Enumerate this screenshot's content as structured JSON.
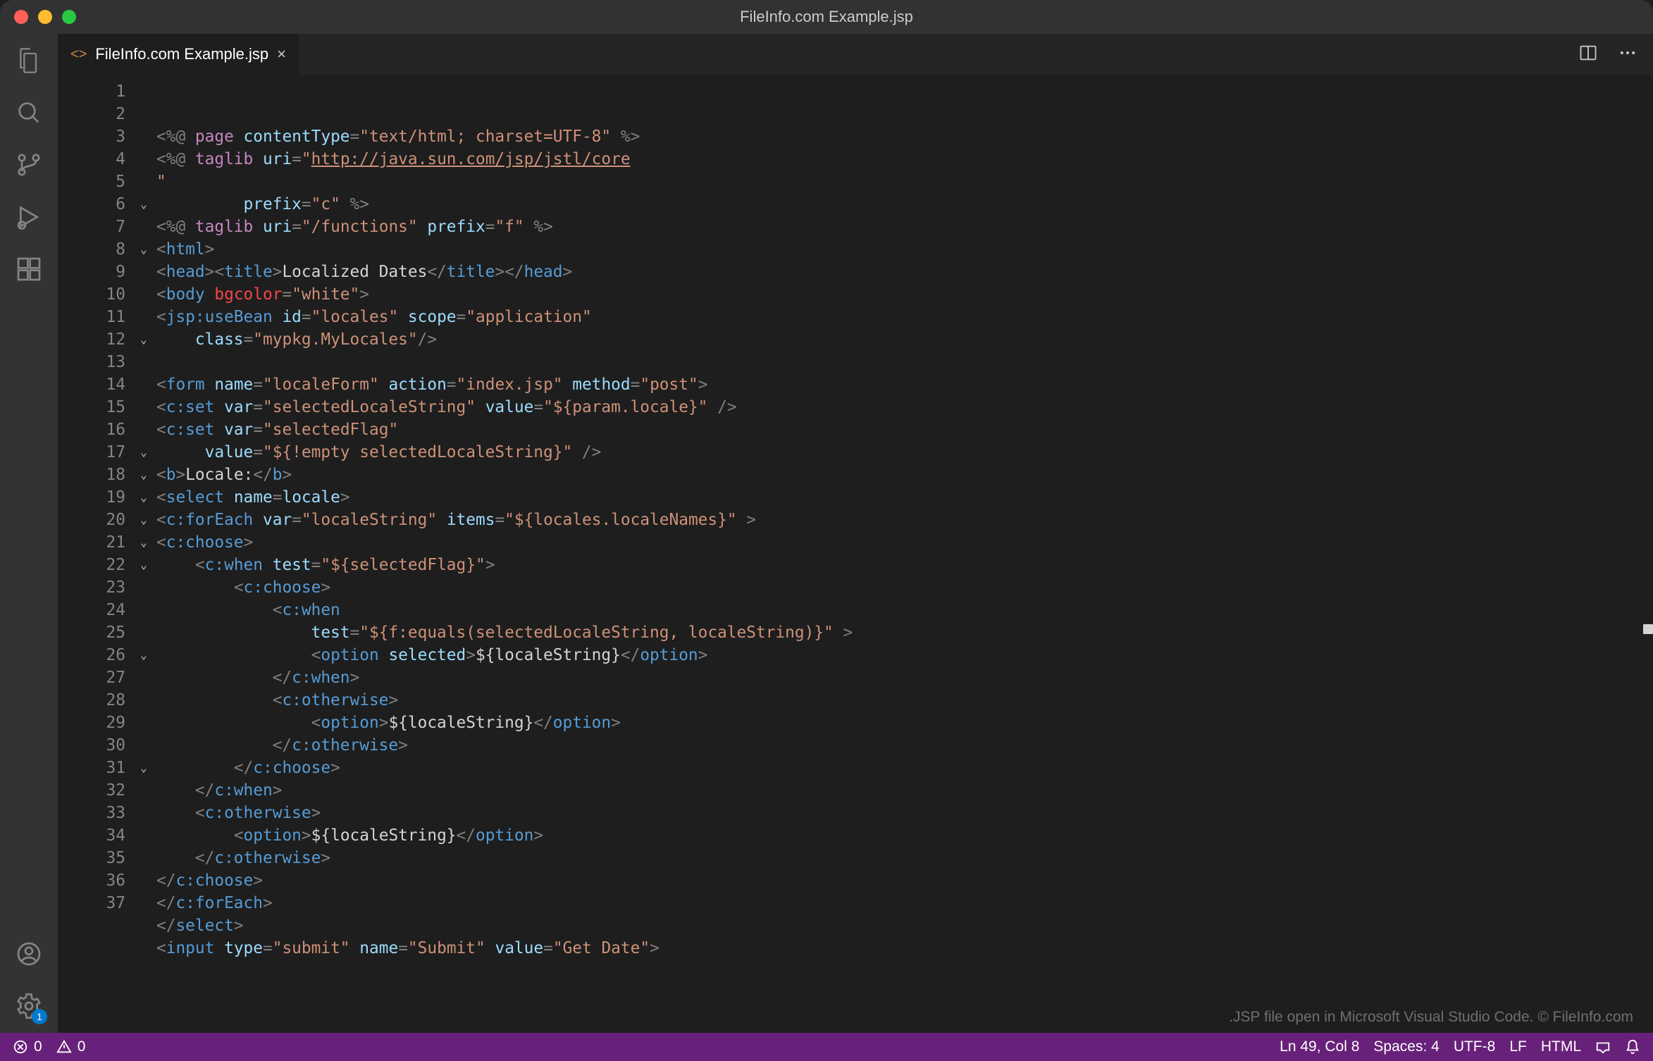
{
  "window": {
    "title": "FileInfo.com Example.jsp"
  },
  "tab": {
    "filename": "FileInfo.com Example.jsp",
    "close_glyph": "×",
    "file_icon": "<>"
  },
  "activity": {
    "settings_badge": "1"
  },
  "hint": ".JSP file open in Microsoft Visual Studio Code. © FileInfo.com",
  "statusbar": {
    "errors": "0",
    "warnings": "0",
    "cursor": "Ln 49, Col 8",
    "indent": "Spaces: 4",
    "encoding": "UTF-8",
    "eol": "LF",
    "language": "HTML"
  },
  "code_lines": [
    {
      "n": 1,
      "f": "",
      "s": [
        [
          "p",
          "<%@ "
        ],
        [
          "dr",
          "page"
        ],
        [
          "p",
          " "
        ],
        [
          "an",
          "contentType"
        ],
        [
          "p",
          "="
        ],
        [
          "av",
          "\"text/html; charset=UTF-8\""
        ],
        [
          "p",
          " %>"
        ]
      ]
    },
    {
      "n": 2,
      "f": "",
      "s": [
        [
          "p",
          "<%@ "
        ],
        [
          "dr",
          "taglib"
        ],
        [
          "p",
          " "
        ],
        [
          "an",
          "uri"
        ],
        [
          "p",
          "="
        ],
        [
          "av",
          "\""
        ],
        [
          "av ul",
          "http://java.sun.com/jsp/jstl/core"
        ]
      ]
    },
    {
      "n": 3,
      "f": "",
      "s": [
        [
          "av",
          "\""
        ]
      ]
    },
    {
      "n": 4,
      "f": "",
      "s": [
        [
          "tx",
          "         "
        ],
        [
          "an",
          "prefix"
        ],
        [
          "p",
          "="
        ],
        [
          "av",
          "\"c\""
        ],
        [
          "p",
          " %>"
        ]
      ]
    },
    {
      "n": 5,
      "f": "",
      "s": [
        [
          "p",
          "<%@ "
        ],
        [
          "dr",
          "taglib"
        ],
        [
          "p",
          " "
        ],
        [
          "an",
          "uri"
        ],
        [
          "p",
          "="
        ],
        [
          "av",
          "\"/functions\""
        ],
        [
          "p",
          " "
        ],
        [
          "an",
          "prefix"
        ],
        [
          "p",
          "="
        ],
        [
          "av",
          "\"f\""
        ],
        [
          "p",
          " %>"
        ]
      ]
    },
    {
      "n": 6,
      "f": "v",
      "s": [
        [
          "p",
          "<"
        ],
        [
          "tg",
          "html"
        ],
        [
          "p",
          ">"
        ]
      ]
    },
    {
      "n": 7,
      "f": "",
      "s": [
        [
          "p",
          "<"
        ],
        [
          "tg",
          "head"
        ],
        [
          "p",
          "><"
        ],
        [
          "tg",
          "title"
        ],
        [
          "p",
          ">"
        ],
        [
          "tx",
          "Localized Dates"
        ],
        [
          "p",
          "</"
        ],
        [
          "tg",
          "title"
        ],
        [
          "p",
          "></"
        ],
        [
          "tg",
          "head"
        ],
        [
          "p",
          ">"
        ]
      ]
    },
    {
      "n": 8,
      "f": "v",
      "s": [
        [
          "p",
          "<"
        ],
        [
          "tg",
          "body"
        ],
        [
          "p",
          " "
        ],
        [
          "rd",
          "bgcolor"
        ],
        [
          "p",
          "="
        ],
        [
          "av",
          "\"white\""
        ],
        [
          "p",
          ">"
        ]
      ]
    },
    {
      "n": 9,
      "f": "",
      "s": [
        [
          "p",
          "<"
        ],
        [
          "tg",
          "jsp:useBean"
        ],
        [
          "p",
          " "
        ],
        [
          "an",
          "id"
        ],
        [
          "p",
          "="
        ],
        [
          "av",
          "\"locales\""
        ],
        [
          "p",
          " "
        ],
        [
          "an",
          "scope"
        ],
        [
          "p",
          "="
        ],
        [
          "av",
          "\"application\""
        ]
      ]
    },
    {
      "n": 10,
      "f": "",
      "s": [
        [
          "tx",
          "    "
        ],
        [
          "an",
          "class"
        ],
        [
          "p",
          "="
        ],
        [
          "av",
          "\"mypkg.MyLocales\""
        ],
        [
          "p",
          "/>"
        ]
      ]
    },
    {
      "n": 11,
      "f": "",
      "s": [
        [
          "tx",
          " "
        ]
      ]
    },
    {
      "n": 12,
      "f": "v",
      "s": [
        [
          "p",
          "<"
        ],
        [
          "tg",
          "form"
        ],
        [
          "p",
          " "
        ],
        [
          "an",
          "name"
        ],
        [
          "p",
          "="
        ],
        [
          "av",
          "\"localeForm\""
        ],
        [
          "p",
          " "
        ],
        [
          "an",
          "action"
        ],
        [
          "p",
          "="
        ],
        [
          "av",
          "\"index.jsp\""
        ],
        [
          "p",
          " "
        ],
        [
          "an",
          "method"
        ],
        [
          "p",
          "="
        ],
        [
          "av",
          "\"post\""
        ],
        [
          "p",
          ">"
        ]
      ]
    },
    {
      "n": 13,
      "f": "",
      "s": [
        [
          "p",
          "<"
        ],
        [
          "tg",
          "c:set"
        ],
        [
          "p",
          " "
        ],
        [
          "an",
          "var"
        ],
        [
          "p",
          "="
        ],
        [
          "av",
          "\"selectedLocaleString\""
        ],
        [
          "p",
          " "
        ],
        [
          "an",
          "value"
        ],
        [
          "p",
          "="
        ],
        [
          "av",
          "\"${param.locale}\""
        ],
        [
          "p",
          " />"
        ]
      ]
    },
    {
      "n": 14,
      "f": "",
      "s": [
        [
          "p",
          "<"
        ],
        [
          "tg",
          "c:set"
        ],
        [
          "p",
          " "
        ],
        [
          "an",
          "var"
        ],
        [
          "p",
          "="
        ],
        [
          "av",
          "\"selectedFlag\""
        ]
      ]
    },
    {
      "n": 15,
      "f": "",
      "s": [
        [
          "tx",
          "     "
        ],
        [
          "an",
          "value"
        ],
        [
          "p",
          "="
        ],
        [
          "av",
          "\"${!empty selectedLocaleString}\""
        ],
        [
          "p",
          " />"
        ]
      ]
    },
    {
      "n": 16,
      "f": "",
      "s": [
        [
          "p",
          "<"
        ],
        [
          "tg",
          "b"
        ],
        [
          "p",
          ">"
        ],
        [
          "tx",
          "Locale:"
        ],
        [
          "p",
          "</"
        ],
        [
          "tg",
          "b"
        ],
        [
          "p",
          ">"
        ]
      ]
    },
    {
      "n": 17,
      "f": "v",
      "s": [
        [
          "p",
          "<"
        ],
        [
          "tg",
          "select"
        ],
        [
          "p",
          " "
        ],
        [
          "an",
          "name"
        ],
        [
          "p",
          "="
        ],
        [
          "an",
          "locale"
        ],
        [
          "p",
          ">"
        ]
      ]
    },
    {
      "n": 18,
      "f": "v",
      "s": [
        [
          "p",
          "<"
        ],
        [
          "tg",
          "c:forEach"
        ],
        [
          "p",
          " "
        ],
        [
          "an",
          "var"
        ],
        [
          "p",
          "="
        ],
        [
          "av",
          "\"localeString\""
        ],
        [
          "p",
          " "
        ],
        [
          "an",
          "items"
        ],
        [
          "p",
          "="
        ],
        [
          "av",
          "\"${locales.localeNames}\""
        ],
        [
          "p",
          " >"
        ]
      ]
    },
    {
      "n": 19,
      "f": "v",
      "s": [
        [
          "p",
          "<"
        ],
        [
          "tg",
          "c:choose"
        ],
        [
          "p",
          ">"
        ]
      ]
    },
    {
      "n": 20,
      "f": "v",
      "s": [
        [
          "tx",
          "    "
        ],
        [
          "p",
          "<"
        ],
        [
          "tg",
          "c:when"
        ],
        [
          "p",
          " "
        ],
        [
          "an",
          "test"
        ],
        [
          "p",
          "="
        ],
        [
          "av",
          "\"${selectedFlag}\""
        ],
        [
          "p",
          ">"
        ]
      ]
    },
    {
      "n": 21,
      "f": "v",
      "s": [
        [
          "tx",
          "        "
        ],
        [
          "p",
          "<"
        ],
        [
          "tg",
          "c:choose"
        ],
        [
          "p",
          ">"
        ]
      ]
    },
    {
      "n": 22,
      "f": "v",
      "s": [
        [
          "tx",
          "            "
        ],
        [
          "p",
          "<"
        ],
        [
          "tg",
          "c:when"
        ]
      ]
    },
    {
      "n": 23,
      "f": "",
      "s": [
        [
          "tx",
          "                "
        ],
        [
          "an",
          "test"
        ],
        [
          "p",
          "="
        ],
        [
          "av",
          "\"${f:equals(selectedLocaleString, localeString)}\""
        ],
        [
          "p",
          " >"
        ]
      ]
    },
    {
      "n": 24,
      "f": "",
      "s": [
        [
          "tx",
          "                "
        ],
        [
          "p",
          "<"
        ],
        [
          "tg",
          "option"
        ],
        [
          "p",
          " "
        ],
        [
          "an",
          "selected"
        ],
        [
          "p",
          ">"
        ],
        [
          "tx",
          "${localeString}"
        ],
        [
          "p",
          "</"
        ],
        [
          "tg",
          "option"
        ],
        [
          "p",
          ">"
        ]
      ]
    },
    {
      "n": 25,
      "f": "",
      "s": [
        [
          "tx",
          "            "
        ],
        [
          "p",
          "</"
        ],
        [
          "tg",
          "c:when"
        ],
        [
          "p",
          ">"
        ]
      ]
    },
    {
      "n": 26,
      "f": "v",
      "s": [
        [
          "tx",
          "            "
        ],
        [
          "p",
          "<"
        ],
        [
          "tg",
          "c:otherwise"
        ],
        [
          "p",
          ">"
        ]
      ]
    },
    {
      "n": 27,
      "f": "",
      "s": [
        [
          "tx",
          "                "
        ],
        [
          "p",
          "<"
        ],
        [
          "tg",
          "option"
        ],
        [
          "p",
          ">"
        ],
        [
          "tx",
          "${localeString}"
        ],
        [
          "p",
          "</"
        ],
        [
          "tg",
          "option"
        ],
        [
          "p",
          ">"
        ]
      ]
    },
    {
      "n": 28,
      "f": "",
      "s": [
        [
          "tx",
          "            "
        ],
        [
          "p",
          "</"
        ],
        [
          "tg",
          "c:otherwise"
        ],
        [
          "p",
          ">"
        ]
      ]
    },
    {
      "n": 29,
      "f": "",
      "s": [
        [
          "tx",
          "        "
        ],
        [
          "p",
          "</"
        ],
        [
          "tg",
          "c:choose"
        ],
        [
          "p",
          ">"
        ]
      ]
    },
    {
      "n": 30,
      "f": "",
      "s": [
        [
          "tx",
          "    "
        ],
        [
          "p",
          "</"
        ],
        [
          "tg",
          "c:when"
        ],
        [
          "p",
          ">"
        ]
      ]
    },
    {
      "n": 31,
      "f": "v",
      "s": [
        [
          "tx",
          "    "
        ],
        [
          "p",
          "<"
        ],
        [
          "tg",
          "c:otherwise"
        ],
        [
          "p",
          ">"
        ]
      ]
    },
    {
      "n": 32,
      "f": "",
      "s": [
        [
          "tx",
          "        "
        ],
        [
          "p",
          "<"
        ],
        [
          "tg",
          "option"
        ],
        [
          "p",
          ">"
        ],
        [
          "tx",
          "${localeString}"
        ],
        [
          "p",
          "</"
        ],
        [
          "tg",
          "option"
        ],
        [
          "p",
          ">"
        ]
      ]
    },
    {
      "n": 33,
      "f": "",
      "s": [
        [
          "tx",
          "    "
        ],
        [
          "p",
          "</"
        ],
        [
          "tg",
          "c:otherwise"
        ],
        [
          "p",
          ">"
        ]
      ]
    },
    {
      "n": 34,
      "f": "",
      "s": [
        [
          "p",
          "</"
        ],
        [
          "tg",
          "c:choose"
        ],
        [
          "p",
          ">"
        ]
      ]
    },
    {
      "n": 35,
      "f": "",
      "s": [
        [
          "p",
          "</"
        ],
        [
          "tg",
          "c:forEach"
        ],
        [
          "p",
          ">"
        ]
      ]
    },
    {
      "n": 36,
      "f": "",
      "s": [
        [
          "p",
          "</"
        ],
        [
          "tg",
          "select"
        ],
        [
          "p",
          ">"
        ]
      ]
    },
    {
      "n": 37,
      "f": "",
      "s": [
        [
          "p",
          "<"
        ],
        [
          "tg",
          "input"
        ],
        [
          "p",
          " "
        ],
        [
          "an",
          "type"
        ],
        [
          "p",
          "="
        ],
        [
          "av",
          "\"submit\""
        ],
        [
          "p",
          " "
        ],
        [
          "an",
          "name"
        ],
        [
          "p",
          "="
        ],
        [
          "av",
          "\"Submit\""
        ],
        [
          "p",
          " "
        ],
        [
          "an",
          "value"
        ],
        [
          "p",
          "="
        ],
        [
          "av",
          "\"Get Date\""
        ],
        [
          "p",
          ">"
        ]
      ]
    }
  ]
}
